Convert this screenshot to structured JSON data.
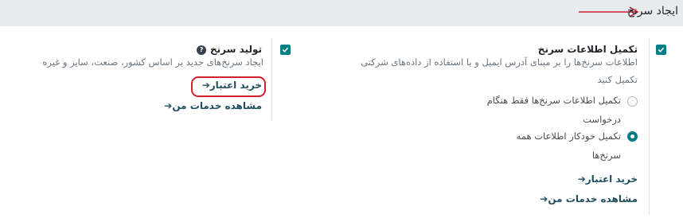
{
  "header": {
    "title": "ایجاد سرنخ"
  },
  "enrich": {
    "title": "تکمیل اطلاعات سرنخ",
    "description_lines": [
      "اطلاعات سرنخ‌ها را بر مبنای آدرس ایمیل و با استفاده از داده‌های شرکتی",
      "تکمیل کنید"
    ],
    "options": [
      {
        "label_lines": [
          "تکمیل اطلاعات سرنخ‌ها فقط هنگام",
          "درخواست"
        ],
        "selected": false
      },
      {
        "label_lines": [
          "تکمیل خودکار اطلاعات همه",
          "سرنخ‌ها"
        ],
        "selected": true
      }
    ],
    "buy_credits": "خرید اعتبار",
    "view_services": "مشاهده خدمات من"
  },
  "generate": {
    "title": "تولید سرنخ",
    "description": "ایجاد سرنخ‌های جدید بر اساس کشور، صنعت، سایز و غیره",
    "buy_credits": "خرید اعتبار",
    "view_services": "مشاهده خدمات من"
  },
  "colors": {
    "accent": "#017e84",
    "annotation": "#d0202e",
    "link": "#1f4e5f"
  }
}
